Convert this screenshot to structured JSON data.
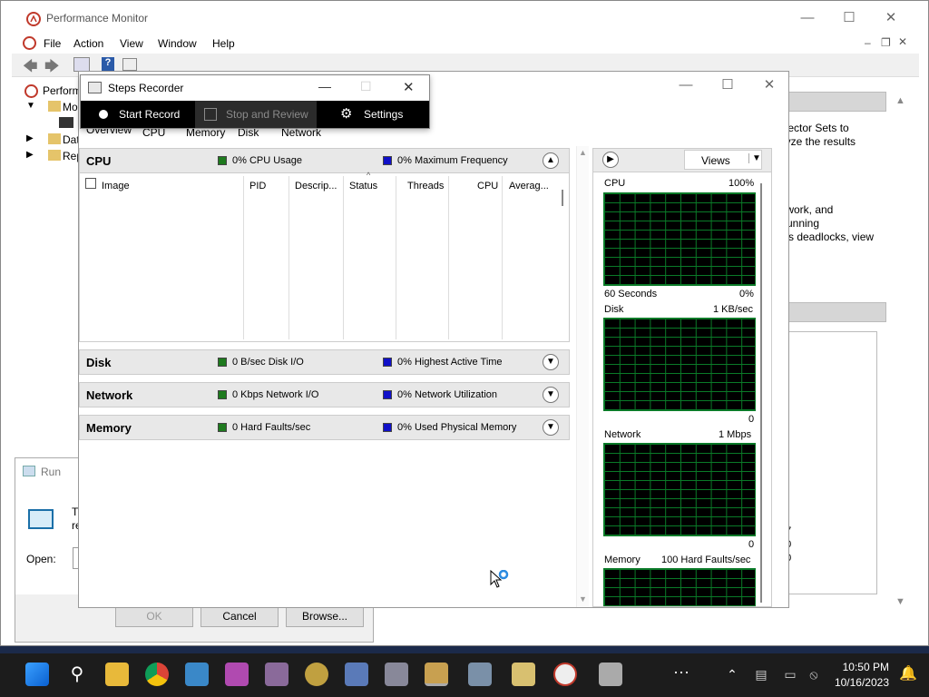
{
  "perfmon": {
    "title": "Performance Monitor",
    "menu": [
      "File",
      "Action",
      "View",
      "Window",
      "Help"
    ],
    "tree": [
      "Performance",
      "Monitoring Tools",
      "Data Collector Sets",
      "Reports"
    ],
    "right_text": [
      "llector Sets to",
      "lyze the results",
      "twork, and",
      "running",
      "ss deadlocks, view"
    ],
    "right_numbers": [
      ",0",
      "37",
      "00",
      "00"
    ]
  },
  "run": {
    "title": "Run",
    "body_text": "T",
    "body_text2": "re",
    "open_label": "Open:",
    "ok": "OK",
    "cancel": "Cancel",
    "browse": "Browse..."
  },
  "steps_recorder": {
    "title": "Steps Recorder",
    "start": "Start Record",
    "stop": "Stop and Review",
    "settings": "Settings"
  },
  "resmon": {
    "tabs": [
      "Overview",
      "CPU",
      "Memory",
      "Disk",
      "Network"
    ],
    "cpu": {
      "title": "CPU",
      "legend1": "0% CPU Usage",
      "legend2": "0% Maximum Frequency",
      "columns": [
        "Image",
        "PID",
        "Descrip...",
        "Status",
        "Threads",
        "CPU",
        "Averag..."
      ]
    },
    "disk": {
      "title": "Disk",
      "legend1": "0 B/sec Disk I/O",
      "legend2": "0% Highest Active Time"
    },
    "network": {
      "title": "Network",
      "legend1": "0 Kbps Network I/O",
      "legend2": "0% Network Utilization"
    },
    "memory": {
      "title": "Memory",
      "legend1": "0 Hard Faults/sec",
      "legend2": "0% Used Physical Memory"
    },
    "graphs": {
      "views": "Views",
      "cpu_label": "CPU",
      "cpu_max": "100%",
      "cpu_time": "60 Seconds",
      "cpu_min": "0%",
      "disk_label": "Disk",
      "disk_max": "1 KB/sec",
      "disk_min": "0",
      "net_label": "Network",
      "net_max": "1 Mbps",
      "net_min": "0",
      "mem_label": "Memory",
      "mem_max": "100 Hard Faults/sec"
    }
  },
  "taskbar": {
    "time": "10:50 PM",
    "date": "10/16/2023"
  },
  "colors": {
    "green": "#1e7a1e",
    "blue": "#1010c8",
    "grid": "#0a7a28"
  }
}
